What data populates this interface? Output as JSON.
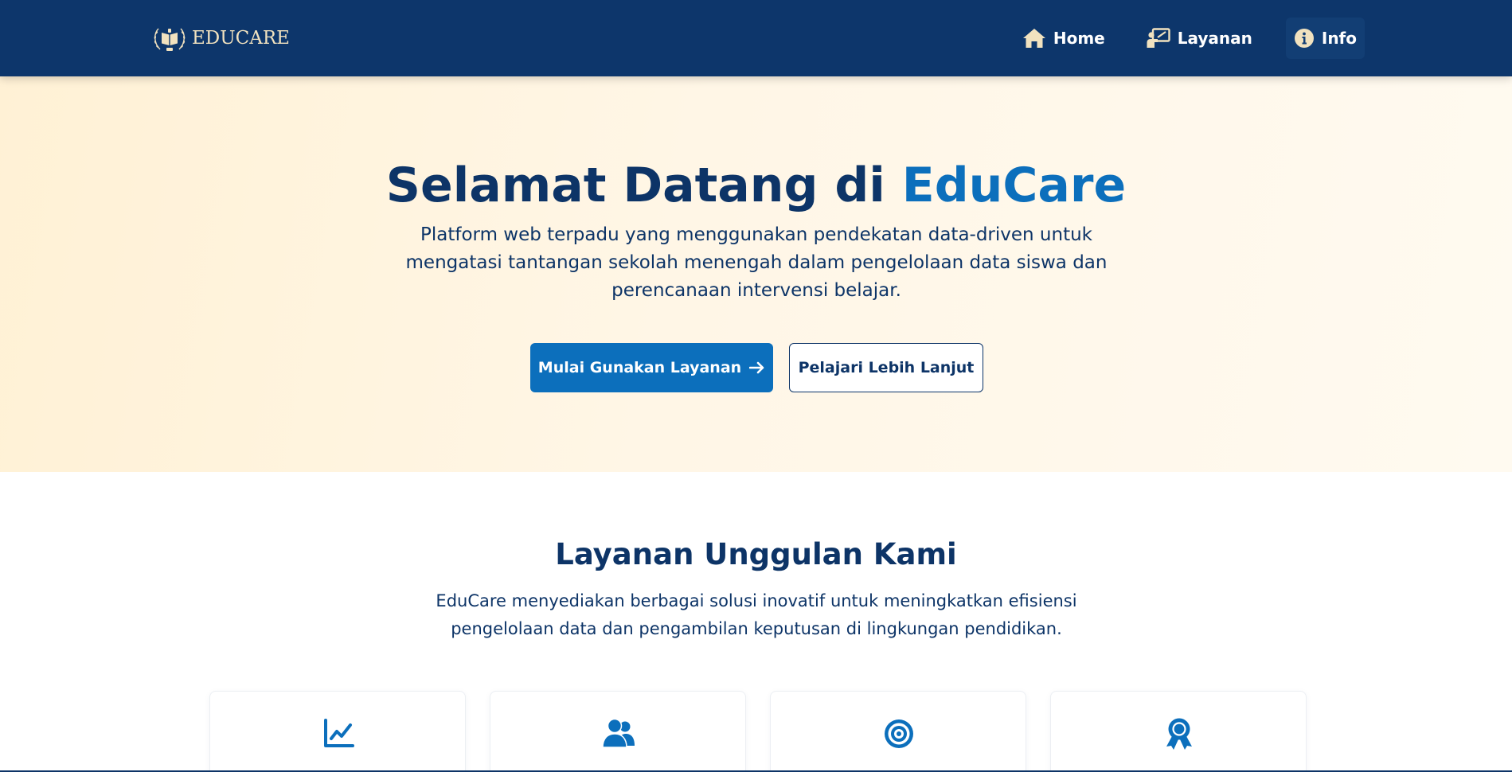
{
  "brand": {
    "name": "EDUCARE",
    "emblem_icon": "book-laurel-logo"
  },
  "nav": {
    "items": [
      {
        "label": "Home",
        "icon": "home-icon"
      },
      {
        "label": "Layanan",
        "icon": "presentation-icon"
      },
      {
        "label": "Info",
        "icon": "info-circle-icon"
      }
    ],
    "active": "Info"
  },
  "hero": {
    "title_prefix": "Selamat Datang di",
    "title_accent": "EduCare",
    "description": "Platform web terpadu yang menggunakan pendekatan data-driven untuk mengatasi tantangan sekolah menengah dalam pengelolaan data siswa dan perencanaan intervensi belajar.",
    "primary_button": "Mulai Gunakan Layanan",
    "secondary_button": "Pelajari Lebih Lanjut"
  },
  "services": {
    "title": "Layanan Unggulan Kami",
    "description": "EduCare menyediakan berbagai solusi inovatif untuk meningkatkan efisiensi pengelolaan data dan pengambilan keputusan di lingkungan pendidikan.",
    "cards": [
      {
        "icon": "line-chart-icon"
      },
      {
        "icon": "users-icon"
      },
      {
        "icon": "target-icon"
      },
      {
        "icon": "award-icon"
      }
    ]
  },
  "colors": {
    "navbar": "#0d366b",
    "primary": "#0c6fbc",
    "text_dark": "#0d3467",
    "brand_gold": "#f1e2bf",
    "hero_bg_start": "#fff1d5",
    "hero_bg_end": "#fffaf0"
  }
}
